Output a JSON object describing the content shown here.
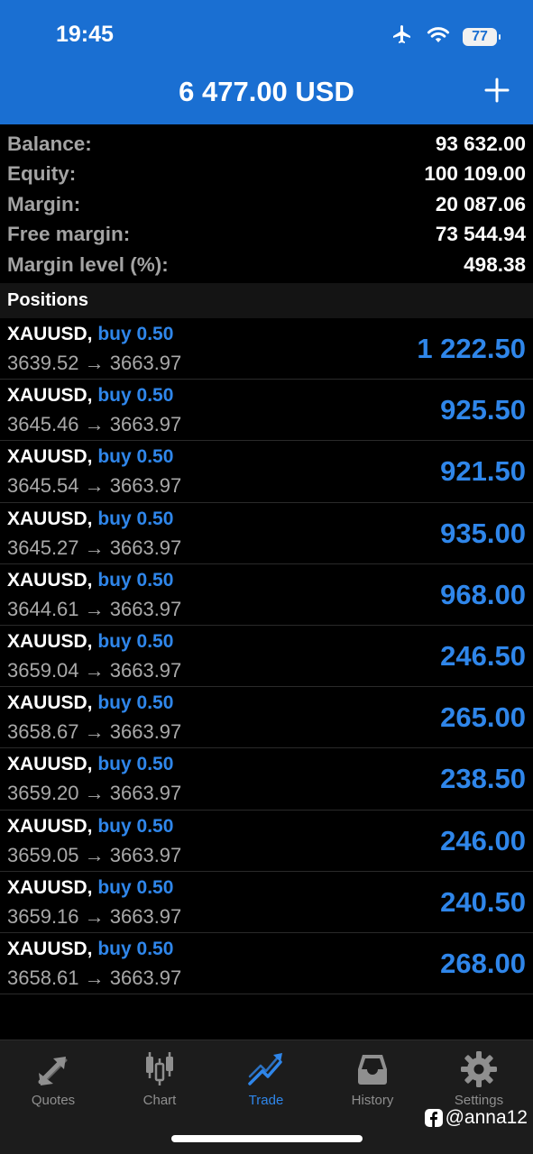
{
  "status_bar": {
    "time": "19:45",
    "battery": "77",
    "icons": [
      "airplane-icon",
      "wifi-icon",
      "battery-icon"
    ]
  },
  "header": {
    "title": "6 477.00 USD",
    "add_icon": "plus-icon"
  },
  "summary": [
    {
      "label": "Balance:",
      "value": "93 632.00"
    },
    {
      "label": "Equity:",
      "value": "100 109.00"
    },
    {
      "label": "Margin:",
      "value": "20 087.06"
    },
    {
      "label": "Free margin:",
      "value": "73 544.94"
    },
    {
      "label": "Margin level (%):",
      "value": "498.38"
    }
  ],
  "positions_header": "Positions",
  "positions": [
    {
      "symbol": "XAUUSD,",
      "side": "buy 0.50",
      "prices": "3639.52 → 3663.97",
      "profit": "1 222.50"
    },
    {
      "symbol": "XAUUSD,",
      "side": "buy 0.50",
      "prices": "3645.46 → 3663.97",
      "profit": "925.50"
    },
    {
      "symbol": "XAUUSD,",
      "side": "buy 0.50",
      "prices": "3645.54 → 3663.97",
      "profit": "921.50"
    },
    {
      "symbol": "XAUUSD,",
      "side": "buy 0.50",
      "prices": "3645.27 → 3663.97",
      "profit": "935.00"
    },
    {
      "symbol": "XAUUSD,",
      "side": "buy 0.50",
      "prices": "3644.61 → 3663.97",
      "profit": "968.00"
    },
    {
      "symbol": "XAUUSD,",
      "side": "buy 0.50",
      "prices": "3659.04 → 3663.97",
      "profit": "246.50"
    },
    {
      "symbol": "XAUUSD,",
      "side": "buy 0.50",
      "prices": "3658.67 → 3663.97",
      "profit": "265.00"
    },
    {
      "symbol": "XAUUSD,",
      "side": "buy 0.50",
      "prices": "3659.20 → 3663.97",
      "profit": "238.50"
    },
    {
      "symbol": "XAUUSD,",
      "side": "buy 0.50",
      "prices": "3659.05 → 3663.97",
      "profit": "246.00"
    },
    {
      "symbol": "XAUUSD,",
      "side": "buy 0.50",
      "prices": "3659.16 → 3663.97",
      "profit": "240.50"
    },
    {
      "symbol": "XAUUSD,",
      "side": "buy 0.50",
      "prices": "3658.61 → 3663.97",
      "profit": "268.00"
    }
  ],
  "tabs": [
    {
      "label": "Quotes",
      "icon": "quotes-arrows-icon",
      "active": false
    },
    {
      "label": "Chart",
      "icon": "candlestick-chart-icon",
      "active": false
    },
    {
      "label": "Trade",
      "icon": "trade-trend-icon",
      "active": true
    },
    {
      "label": "History",
      "icon": "inbox-tray-icon",
      "active": false
    },
    {
      "label": "Settings",
      "icon": "gear-icon",
      "active": false
    }
  ],
  "watermark": {
    "handle": "@anna12",
    "icon": "facebook-icon"
  },
  "colors": {
    "header_bg": "#1a6fd2",
    "accent_blue": "#2f86ea",
    "background": "#000000",
    "tabbar_bg": "#1c1c1c"
  }
}
